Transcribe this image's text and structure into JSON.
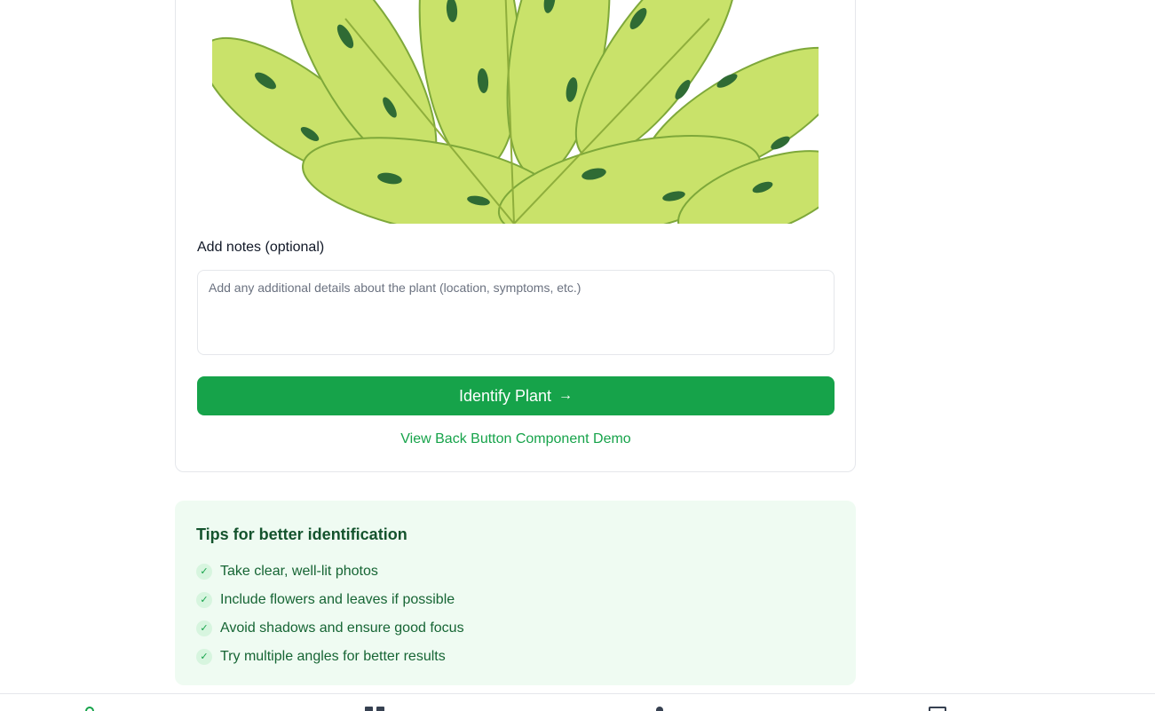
{
  "upload": {
    "notes_label": "Add notes (optional)",
    "notes_placeholder": "Add any additional details about the plant (location, symptoms, etc.)",
    "notes_value": "",
    "identify_label": "Identify Plant",
    "identify_icon": "arrow-right-icon",
    "demo_link": "View Back Button Component Demo"
  },
  "tips": {
    "title": "Tips for better identification",
    "items": [
      "Take clear, well-lit photos",
      "Include flowers and leaves if possible",
      "Avoid shadows and ensure good focus",
      "Try multiple angles for better results"
    ],
    "item_icon": "check-icon"
  },
  "bottom_nav": {
    "icons": [
      "home-icon",
      "grid-icon",
      "user-icon",
      "book-icon"
    ]
  },
  "colors": {
    "primary": "#16a34a",
    "tips_background": "#effbf2",
    "tips_title": "#14532d",
    "tips_text": "#166534",
    "card_border": "#e5e7eb"
  }
}
